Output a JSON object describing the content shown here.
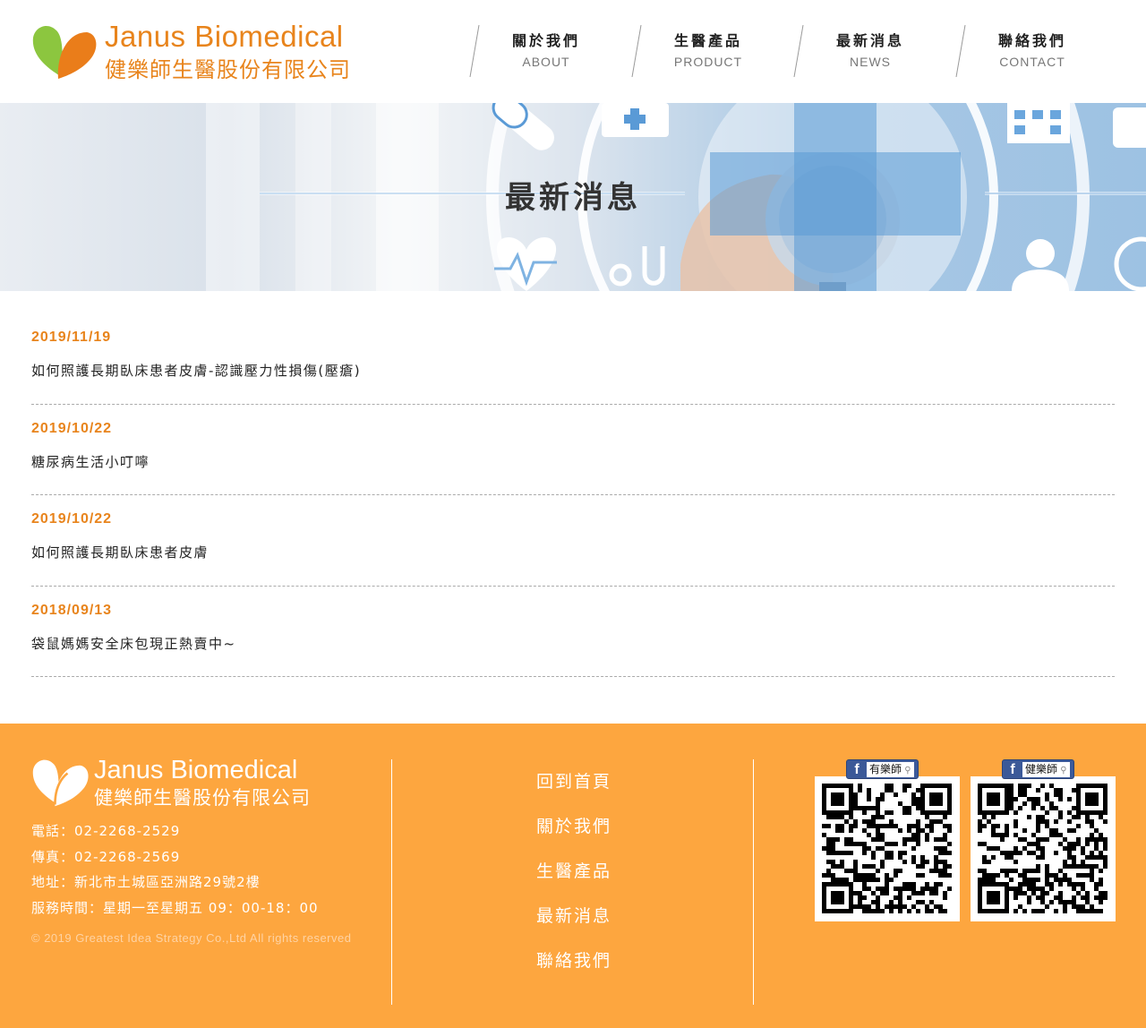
{
  "header": {
    "logo_en": "Janus Biomedical",
    "logo_zh": "健樂師生醫股份有限公司"
  },
  "nav": [
    {
      "zh": "關於我們",
      "en": "ABOUT"
    },
    {
      "zh": "生醫產品",
      "en": "PRODUCT"
    },
    {
      "zh": "最新消息",
      "en": "NEWS"
    },
    {
      "zh": "聯絡我們",
      "en": "CONTACT"
    }
  ],
  "banner": {
    "title": "最新消息"
  },
  "news": [
    {
      "date": "2019/11/19",
      "title": "如何照護長期臥床患者皮膚-認識壓力性損傷(壓瘡)"
    },
    {
      "date": "2019/10/22",
      "title": "糖尿病生活小叮嚀"
    },
    {
      "date": "2019/10/22",
      "title": "如何照護長期臥床患者皮膚"
    },
    {
      "date": "2018/09/13",
      "title": "袋鼠媽媽安全床包現正熱賣中~"
    }
  ],
  "footer": {
    "logo_en": "Janus Biomedical",
    "logo_zh": "健樂師生醫股份有限公司",
    "phone": "電話：02-2268-2529",
    "fax": "傳真：02-2268-2569",
    "address": "地址：新北市土城區亞洲路29號2樓",
    "hours": "服務時間：星期一至星期五 09：00-18：00",
    "copyright": "© 2019 Greatest Idea Strategy Co.,Ltd All rights reserved",
    "nav": [
      "回到首頁",
      "關於我們",
      "生醫產品",
      "最新消息",
      "聯絡我們"
    ],
    "qr_labels": [
      "有樂師",
      "健樂師"
    ]
  },
  "colors": {
    "accent": "#e8841c",
    "footer_bg": "#fda63f",
    "leaf_green": "#8cc63f"
  }
}
